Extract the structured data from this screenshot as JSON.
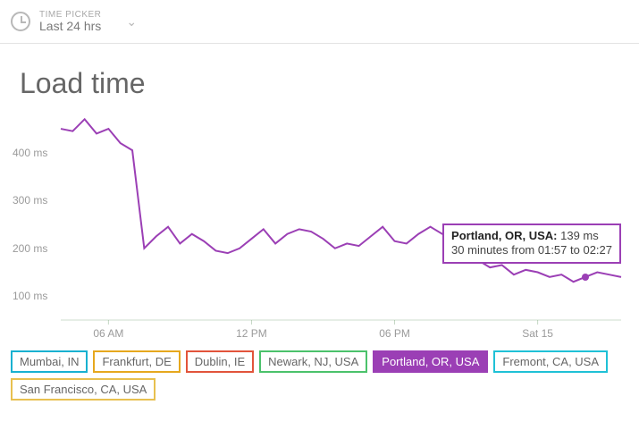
{
  "time_picker": {
    "label": "TIME PICKER",
    "value": "Last 24 hrs"
  },
  "chart_title": "Load time",
  "y_ticks": [
    "100 ms",
    "200 ms",
    "300 ms",
    "400 ms"
  ],
  "x_ticks": [
    "06 AM",
    "12 PM",
    "06 PM",
    "Sat 15"
  ],
  "tooltip": {
    "location": "Portland, OR, USA:",
    "value": "139 ms",
    "sub": "30 minutes from 01:57 to 02:27"
  },
  "legend": [
    {
      "label": "Mumbai, IN",
      "color": "#18b1d0",
      "active": false
    },
    {
      "label": "Frankfurt, DE",
      "color": "#e6a81e",
      "active": false
    },
    {
      "label": "Dublin, IE",
      "color": "#e2543b",
      "active": false
    },
    {
      "label": "Newark, NJ, USA",
      "color": "#4bc26b",
      "active": false
    },
    {
      "label": "Portland, OR, USA",
      "color": "#9b3fb5",
      "active": true
    },
    {
      "label": "Fremont, CA, USA",
      "color": "#1fc1d6",
      "active": false
    },
    {
      "label": "San Francisco, CA, USA",
      "color": "#e8c04f",
      "active": false
    }
  ],
  "chart_data": {
    "type": "line",
    "title": "Load time",
    "ylabel": "ms",
    "xlabel": "",
    "ylim": [
      50,
      480
    ],
    "x": [
      0,
      1,
      2,
      3,
      4,
      5,
      6,
      7,
      8,
      9,
      10,
      11,
      12,
      13,
      14,
      15,
      16,
      17,
      18,
      19,
      20,
      21,
      22,
      23,
      24,
      25,
      26,
      27,
      28,
      29,
      30,
      31,
      32,
      33,
      34,
      35,
      36,
      37,
      38,
      39,
      40,
      41,
      42,
      43,
      44,
      45,
      46,
      47
    ],
    "x_tick_positions": [
      4,
      16,
      28,
      40
    ],
    "x_tick_labels": [
      "06 AM",
      "12 PM",
      "06 PM",
      "Sat 15"
    ],
    "series": [
      {
        "name": "Portland, OR, USA",
        "color": "#9b3fb5",
        "values": [
          450,
          445,
          470,
          440,
          450,
          420,
          405,
          200,
          225,
          245,
          210,
          230,
          215,
          195,
          190,
          200,
          220,
          240,
          210,
          230,
          240,
          235,
          220,
          200,
          210,
          205,
          225,
          245,
          215,
          210,
          230,
          245,
          230,
          235,
          200,
          175,
          160,
          165,
          145,
          155,
          150,
          140,
          145,
          130,
          140,
          150,
          145,
          140
        ]
      }
    ],
    "highlight_point": {
      "series": "Portland, OR, USA",
      "index": 44,
      "value": 139,
      "time_range": "01:57–02:27"
    }
  }
}
